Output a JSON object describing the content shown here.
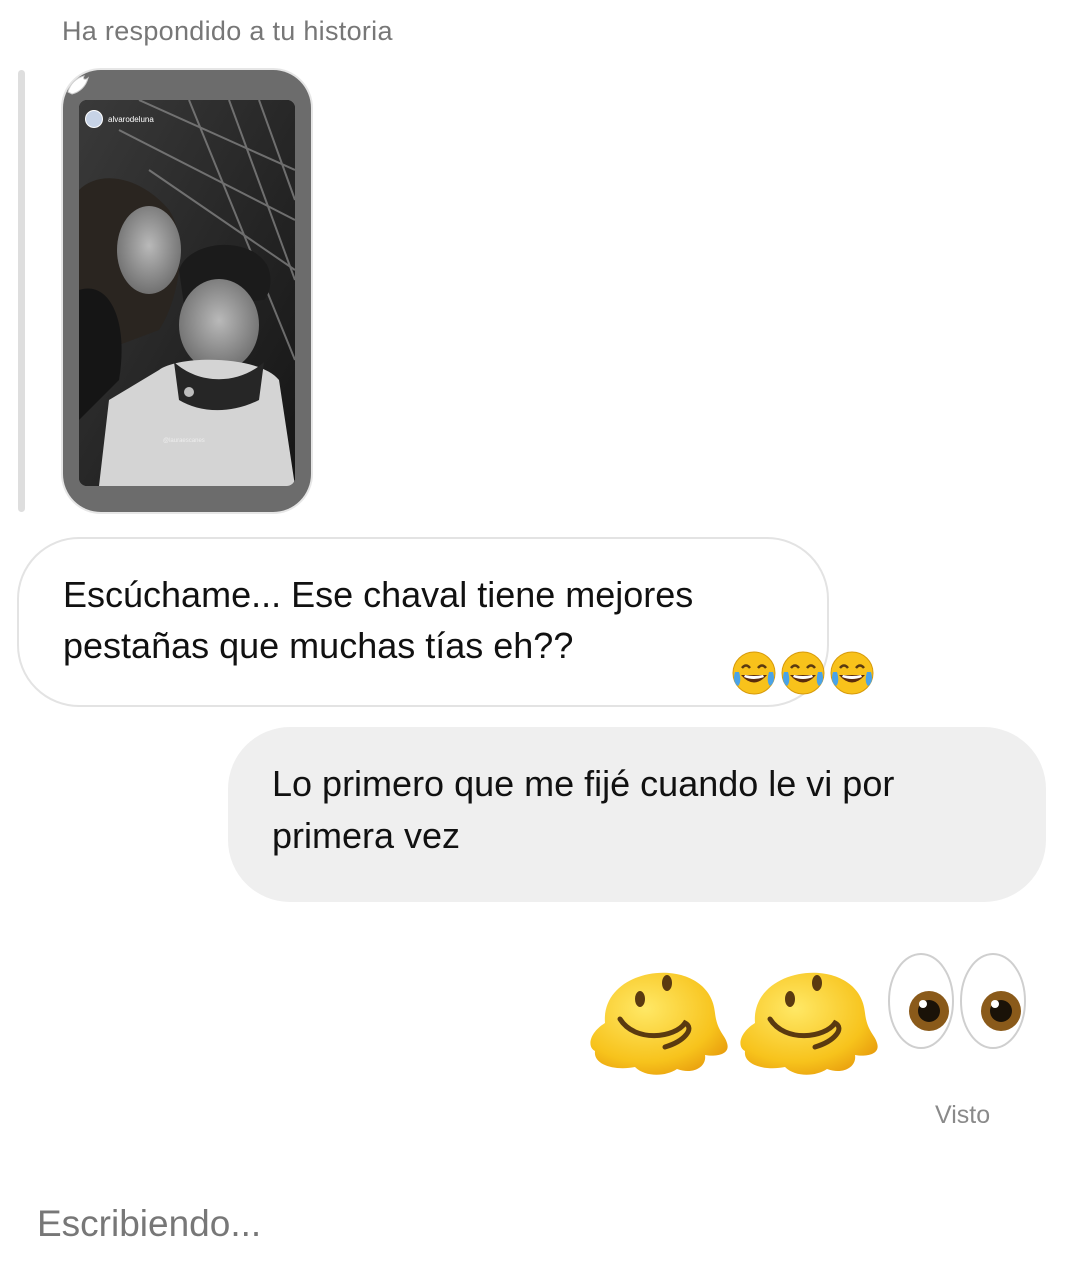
{
  "reply": {
    "header": "Ha respondido a tu historia",
    "story": {
      "username": "alvarodeluna",
      "tag": "@lauraescanes"
    }
  },
  "messages": [
    {
      "direction": "incoming",
      "text": "Escúchame... Ese chaval tiene mejores pestañas que muchas tías eh??",
      "reaction_emojis": [
        "face-with-tears-of-joy",
        "face-with-tears-of-joy",
        "face-with-tears-of-joy"
      ]
    },
    {
      "direction": "outgoing",
      "text": "Lo primero que me fijé cuando le vi por primera vez"
    },
    {
      "direction": "outgoing",
      "emojis": [
        "melting-face",
        "melting-face",
        "eyes"
      ]
    }
  ],
  "status": {
    "seen": "Visto"
  },
  "typing_indicator": "Escribiendo...",
  "colors": {
    "incoming_border": "#e3e3e3",
    "outgoing_bubble": "#efefef",
    "muted_text": "#777777"
  }
}
